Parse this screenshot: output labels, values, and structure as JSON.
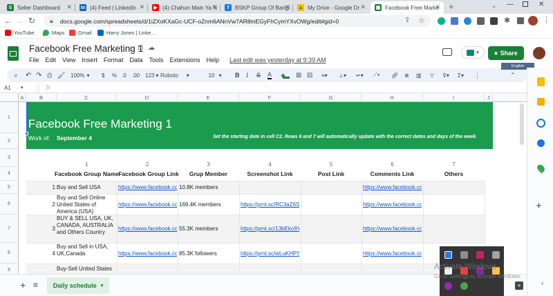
{
  "browser": {
    "tabs": [
      {
        "label": "Seller Dashboard",
        "icon": "seller-dashboard-icon",
        "color": "#188038",
        "glyph": "S"
      },
      {
        "label": "(4) Feed | LinkedIn",
        "icon": "linkedin-icon",
        "color": "#0a66c2",
        "glyph": "in"
      },
      {
        "label": "(4) Chahun Main Ya N",
        "icon": "youtube-icon",
        "color": "#ff0000",
        "glyph": "▶"
      },
      {
        "label": "BSKP Group Of Bangl",
        "icon": "facebook-icon",
        "color": "#1877f2",
        "glyph": "f"
      },
      {
        "label": "My Drive - Google Dr",
        "icon": "google-drive-icon",
        "color": "#fbbc04",
        "glyph": "▲"
      },
      {
        "label": "Facebook Free Marke",
        "icon": "sheets-icon",
        "color": "#188038",
        "glyph": "▦"
      }
    ],
    "new_tab": "+",
    "url": "docs.google.com/spreadsheets/d/1iZXoKXaGc-UCF-oZnm6ANnVw7AR8mEGyFhCymYXvOWg/edit#gid=0",
    "bookmarks": [
      {
        "label": "YouTube",
        "color": "#ff0000"
      },
      {
        "label": "Maps",
        "color": "#34a853"
      },
      {
        "label": "Gmail",
        "color": "#ea4335"
      },
      {
        "label": "Harry Jones | Linke...",
        "color": "#0a66c2"
      }
    ]
  },
  "sheets": {
    "title": "Facebook Free Marketing 1",
    "menu": [
      "File",
      "Edit",
      "View",
      "Insert",
      "Format",
      "Data",
      "Tools",
      "Extensions",
      "Help"
    ],
    "last_edit": "Last edit was yesterday at 9:39 AM",
    "share_label": "Share",
    "toolbar": {
      "zoom": "100%",
      "currency": "$",
      "percent": "%",
      "dec_less": ".0",
      "dec_more": ".00",
      "format_123": "123",
      "font": "Roboto",
      "font_size": "10",
      "bold": "B",
      "italic": "I",
      "strike": "S",
      "text_color": "A"
    },
    "name_box": "A1",
    "fx": "fx",
    "columns": [
      "A",
      "B",
      "C",
      "D",
      "E",
      "F",
      "G",
      "H",
      "I",
      "J"
    ],
    "rows": [
      "1",
      "2",
      "3",
      "4",
      "5",
      "6",
      "7",
      "8",
      "9"
    ],
    "banner": {
      "title": "Facebook Free Marketing 1",
      "work_of_label": "Work of:",
      "work_of_value": "September 4",
      "note": "Set the starting date in cell C2. Rows 6 and 7 will automatically update with the correct dates and days of the week."
    },
    "column_numbers": [
      "1",
      "2",
      "3",
      "4",
      "5",
      "6",
      "7"
    ],
    "column_headers": [
      "Facebook Group Name",
      "Facebook Group Link",
      "Grup Member",
      "Screenshot Link",
      "Post Link",
      "Comments Link",
      "Others"
    ],
    "data_rows": [
      {
        "num": "1",
        "name": "Buy and Sell USA",
        "link": "https://www.facebook.cc",
        "members": "10.8K members",
        "screenshot": "",
        "post": "",
        "comments": "https://www.facebook.cc",
        "others": ""
      },
      {
        "num": "2",
        "name": "Buy and Sell Online United States of America (USA)",
        "link": "https://www.facebook.cc",
        "members": "169.4K members",
        "screenshot": "https://prnt.sc/RC3aZ6S",
        "post": "",
        "comments": "https://www.facebook.cc",
        "others": ""
      },
      {
        "num": "3",
        "name": "BUY & SELL USA, UK, CANADA, AUSTRALIA and Others Country",
        "link": "https://www.facebook.cc",
        "members": "55.3K members",
        "screenshot": "https://prnt.sc/13bEko9Y",
        "post": "",
        "comments": "https://www.facebook.cc",
        "others": ""
      },
      {
        "num": "4",
        "name": "Buy and Sell in USA, UK,Canada",
        "link": "https://www.facebook.cc",
        "members": "85.3K followers",
        "screenshot": "https://prnt.sc/wLuKHPS",
        "post": "",
        "comments": "https://www.facebook.cc",
        "others": ""
      },
      {
        "num": "",
        "name": "Buy-Sell United States",
        "link": "",
        "members": "",
        "screenshot": "",
        "post": "",
        "comments": "",
        "others": ""
      }
    ],
    "sheet_tab": "Daily schedule",
    "add_sheet": "+",
    "all_sheets": "≡"
  },
  "sidepanel": {
    "english_badge": "English"
  },
  "windows": {
    "activate_title": "Activate Windows",
    "activate_sub": "Go to Settings to activate Windows."
  },
  "colors": {
    "banner": "#1a9b4d",
    "sheets_green": "#188038",
    "link": "#1155cc",
    "share_button": "#188038",
    "row_band": "#f3f3f3"
  }
}
